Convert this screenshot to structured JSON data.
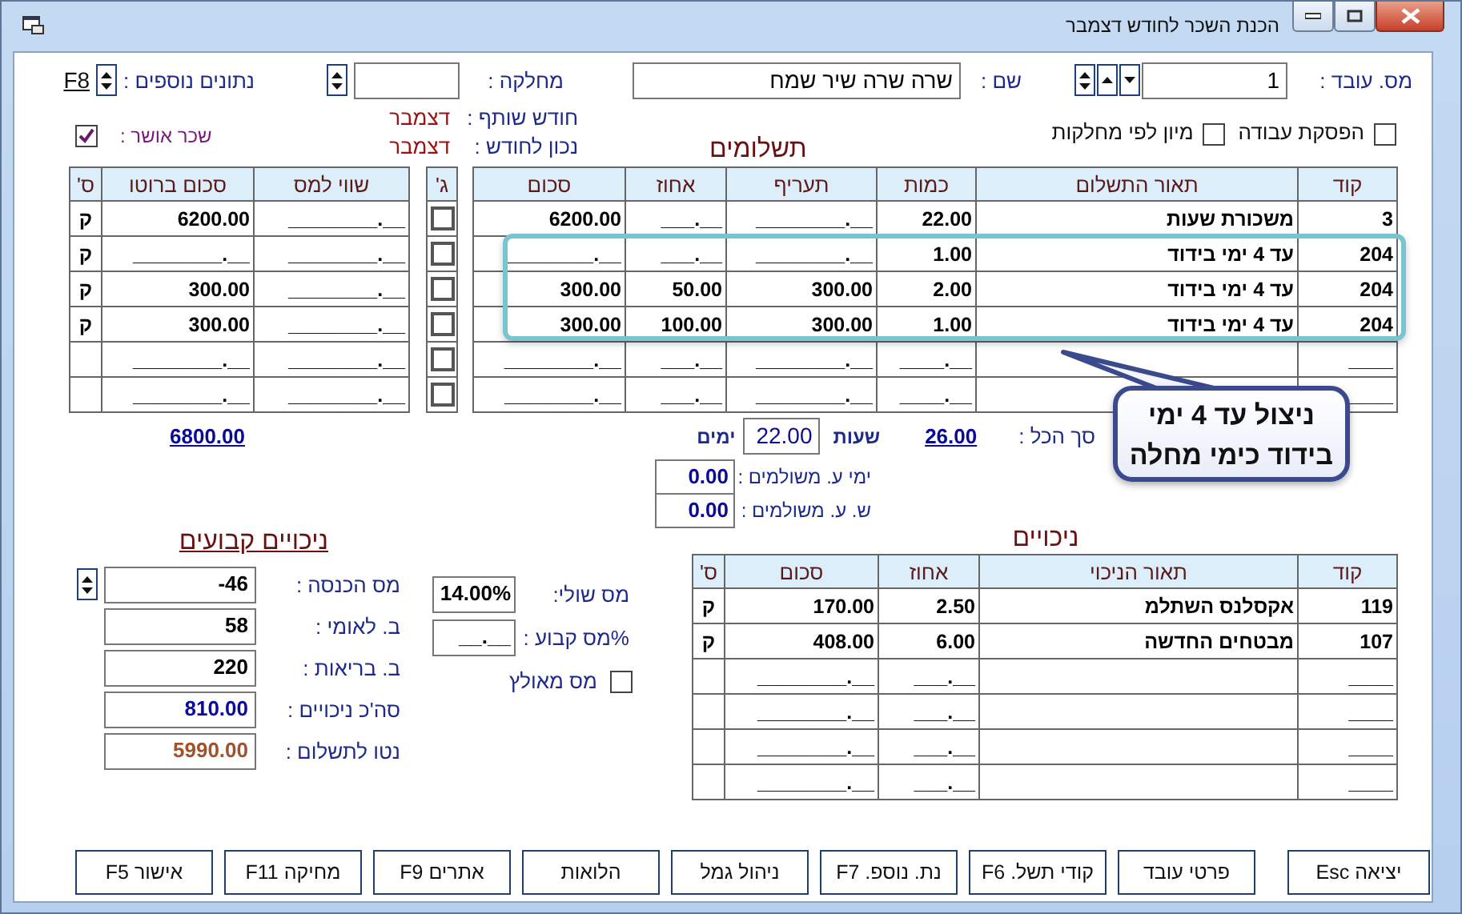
{
  "window": {
    "title": "הכנת השכר לחודש דצמבר"
  },
  "header": {
    "employee_no_label": "מס. עובד :",
    "employee_no": "1",
    "name_label": "שם :",
    "name": "שרה שרה שיר שמח",
    "department_label": "מחלקה :",
    "extra_data_label": "נתונים נוספים :",
    "extra_data_key": "F8"
  },
  "options": [
    {
      "label": "הפסקת עבודה",
      "checked": false
    },
    {
      "label": "מיון לפי מחלקות",
      "checked": false
    }
  ],
  "payments_title": "תשלומים",
  "month_info": [
    {
      "label": "חודש שותף :",
      "value": "דצמבר"
    },
    {
      "label": "נכון לחודש :",
      "value": "דצמבר"
    }
  ],
  "salary_approved": {
    "label": "שכר אושר :",
    "checked": true
  },
  "payments": {
    "columns": [
      "קוד",
      "תאור התשלום",
      "כמות",
      "תעריף",
      "אחוז",
      "סכום"
    ],
    "rows": [
      {
        "code": "3",
        "description": "משכורת שעות",
        "quantity": "22.00",
        "rate": "________.__",
        "percent": "___.__",
        "amount": "6200.00"
      },
      {
        "code": "204",
        "description": "עד 4 ימי בידוד",
        "quantity": "1.00",
        "rate": "________.__",
        "percent": "___.__",
        "amount": "________.__"
      },
      {
        "code": "204",
        "description": "עד 4 ימי בידוד",
        "quantity": "2.00",
        "rate": "300.00",
        "percent": "50.00",
        "amount": "300.00"
      },
      {
        "code": "204",
        "description": "עד 4 ימי בידוד",
        "quantity": "1.00",
        "rate": "300.00",
        "percent": "100.00",
        "amount": "300.00"
      },
      {
        "code": "____",
        "quantity": "____.__",
        "rate": "________.__",
        "percent": "___.__",
        "amount": "________.__"
      },
      {
        "code": "____",
        "quantity": "____.__",
        "rate": "________.__",
        "percent": "___.__",
        "amount": "________.__"
      }
    ]
  },
  "tax_table": {
    "check_column": "ג'",
    "columns": [
      "שווי למס",
      "סכום ברוטו",
      "ס'"
    ],
    "rows": [
      {
        "checked": false,
        "tax_value": "________.__",
        "gross": "6200.00",
        "s": "ק"
      },
      {
        "checked": false,
        "tax_value": "________.__",
        "gross": "________.__",
        "s": "ק"
      },
      {
        "checked": false,
        "tax_value": "________.__",
        "gross": "300.00",
        "s": "ק"
      },
      {
        "checked": false,
        "tax_value": "________.__",
        "gross": "300.00",
        "s": "ק"
      },
      {
        "checked": false,
        "tax_value": "________.__",
        "gross": "________.__"
      },
      {
        "checked": false,
        "tax_value": "________.__",
        "gross": "________.__"
      }
    ]
  },
  "totals": {
    "total_label": "סך הכל :",
    "total": "26.00",
    "hours_label": "שעות",
    "hours": "22.00",
    "days_label": "ימים",
    "gross_total": "6800.00",
    "paid_fields": [
      {
        "label": "ימי ע. משולמים :",
        "value": "0.00"
      },
      {
        "label": "ש. ע. משולמים :",
        "value": "0.00"
      }
    ]
  },
  "fixed_deductions": {
    "title": "ניכויים קבועים",
    "fields": [
      {
        "label": "מס הכנסה :",
        "value": "-46",
        "kind": "spin",
        "color": "#000000"
      },
      {
        "label": "ב. לאומי :",
        "value": "58",
        "kind": "plain",
        "color": "#000000"
      },
      {
        "label": "ב. בריאות :",
        "value": "220",
        "kind": "plain",
        "color": "#000000"
      },
      {
        "label": "סה'כ ניכויים :",
        "value": "810.00",
        "kind": "plain",
        "color": "#0a0aa0"
      },
      {
        "label": "נטו לתשלום :",
        "value": "5990.00",
        "kind": "plain",
        "color": "#a0522d"
      }
    ]
  },
  "tax_settings": {
    "marginal_label": "מס שולי:",
    "marginal": "14.00%",
    "fixed_label": "%מס קבוע :",
    "fixed": "__.__",
    "forced": {
      "label": "מס מאולץ",
      "checked": false
    }
  },
  "deductions": {
    "title": "ניכויים",
    "columns": [
      "קוד",
      "תאור הניכוי",
      "אחוז",
      "סכום",
      "ס'"
    ],
    "rows": [
      {
        "code": "119",
        "description": "אקסלנס השתלמ",
        "percent": "2.50",
        "amount": "170.00",
        "s": "ק"
      },
      {
        "code": "107",
        "description": "מבטחים החדשה",
        "percent": "6.00",
        "amount": "408.00",
        "s": "ק"
      },
      {
        "code": "____",
        "percent": "___.__",
        "amount": "________.__"
      },
      {
        "code": "____",
        "percent": "___.__",
        "amount": "________.__"
      },
      {
        "code": "____",
        "percent": "___.__",
        "amount": "________.__"
      },
      {
        "code": "____",
        "percent": "___.__",
        "amount": "________.__"
      }
    ]
  },
  "callout": {
    "lines": [
      "ניצול עד 4 ימי",
      "בידוד כימי מחלה"
    ]
  },
  "buttons": [
    "יציאה Esc",
    "פרטי עובד",
    "קודי תשל. F6",
    "נת. נוספ. F7",
    "ניהול גמל",
    "הלואות",
    "אתרים F9",
    "מחיקה F11",
    "אישור F5"
  ]
}
